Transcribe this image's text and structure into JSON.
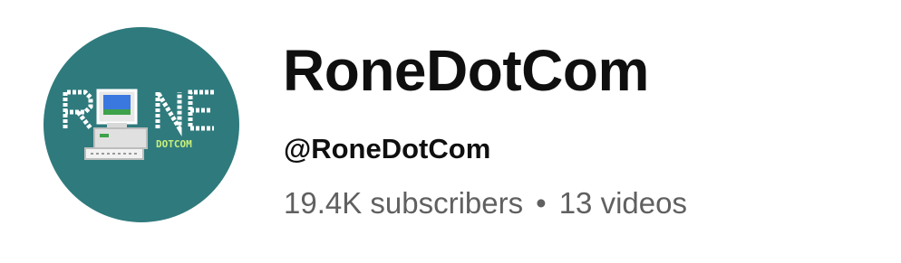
{
  "channel": {
    "name": "RoneDotCom",
    "handle": "@RoneDotCom",
    "subscribers": "19.4K subscribers",
    "separator": "•",
    "videos": "13 videos"
  },
  "avatar": {
    "logo_text_main": "RONE",
    "logo_text_sub": "DOTCOM",
    "background_color": "#2f7a7d",
    "icon": "retro-computer-icon"
  },
  "colors": {
    "primary_text": "#0f0f0f",
    "secondary_text": "#606060"
  }
}
